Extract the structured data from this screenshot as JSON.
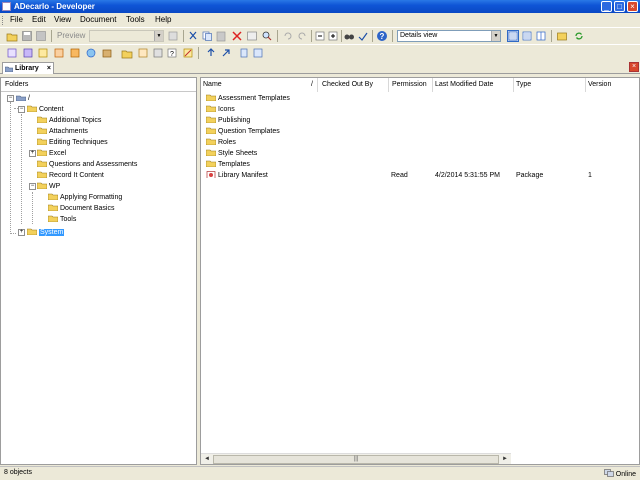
{
  "window": {
    "title": "ADecarlo - Developer",
    "min_glyph": "_",
    "max_glyph": "□",
    "close_glyph": "×"
  },
  "menu": [
    "File",
    "Edit",
    "View",
    "Document",
    "Tools",
    "Help"
  ],
  "toolbar1": {
    "preview_label": "Preview",
    "view_combo": "Details view"
  },
  "tab": {
    "label": "Library",
    "close_glyph": "×"
  },
  "panel_close_glyph": "×",
  "folders": {
    "header": "Folders",
    "tree": [
      {
        "label": "/",
        "expander": "−"
      },
      {
        "label": "Content",
        "expander": "−"
      },
      {
        "label": "Additional Topics"
      },
      {
        "label": "Attachments"
      },
      {
        "label": "Editing Techniques"
      },
      {
        "label": "Excel",
        "expander": "+"
      },
      {
        "label": "Questions and Assessments"
      },
      {
        "label": "Record It Content"
      },
      {
        "label": "WP",
        "expander": "−"
      },
      {
        "label": "Applying Formatting"
      },
      {
        "label": "Document Basics"
      },
      {
        "label": "Tools"
      },
      {
        "label": "System",
        "expander": "+",
        "selected": true
      }
    ]
  },
  "details": {
    "columns": [
      "Name",
      "Checked Out By",
      "Permission",
      "Last Modified Date",
      "Type",
      "Version"
    ],
    "sort_glyph": "/",
    "rows": [
      {
        "name": "Assessment Templates",
        "kind": "folder"
      },
      {
        "name": "Icons",
        "kind": "folder"
      },
      {
        "name": "Publishing",
        "kind": "folder"
      },
      {
        "name": "Question Templates",
        "kind": "folder"
      },
      {
        "name": "Roles",
        "kind": "folder"
      },
      {
        "name": "Style Sheets",
        "kind": "folder"
      },
      {
        "name": "Templates",
        "kind": "folder"
      },
      {
        "name": "Library Manifest",
        "kind": "manifest",
        "permission": "Read",
        "modified": "4/2/2014 5:31:55 PM",
        "type": "Package",
        "version": "1"
      }
    ],
    "scroll_left": "◄",
    "scroll_right": "►",
    "scroll_grip": "|||"
  },
  "status": {
    "count": "8 objects",
    "connection": "Online"
  },
  "colors": {
    "selection": "#3399ff",
    "folder": "#f3d15c",
    "titlebar": "#0f55d6"
  }
}
